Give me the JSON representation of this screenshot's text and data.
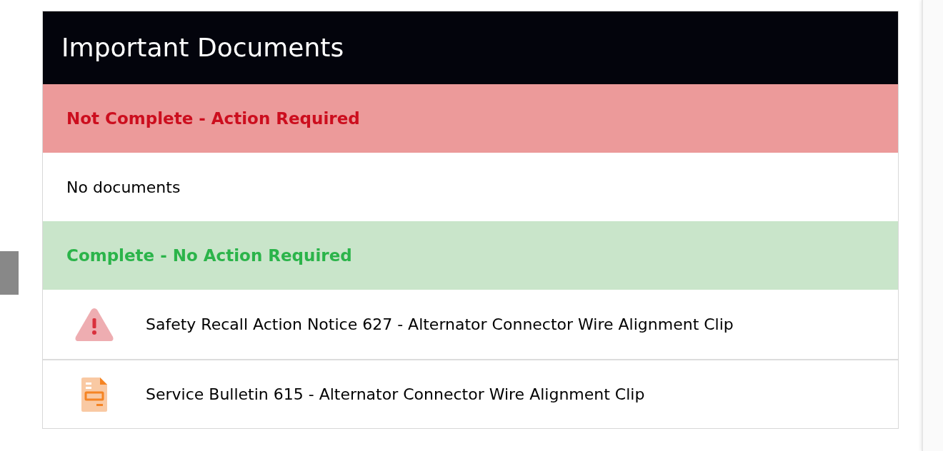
{
  "title": "Important Documents",
  "sections": [
    {
      "kind": "not_complete",
      "heading": "Not Complete - Action Required",
      "empty_text": "No documents"
    },
    {
      "kind": "complete",
      "heading": "Complete - No Action Required",
      "documents": [
        {
          "kind": "recall",
          "title": "Safety Recall Action Notice 627 - Alternator Connector Wire Alignment Clip"
        },
        {
          "kind": "bulletin",
          "title": "Service Bulletin 615 - Alternator Connector Wire Alignment Clip"
        }
      ]
    }
  ]
}
